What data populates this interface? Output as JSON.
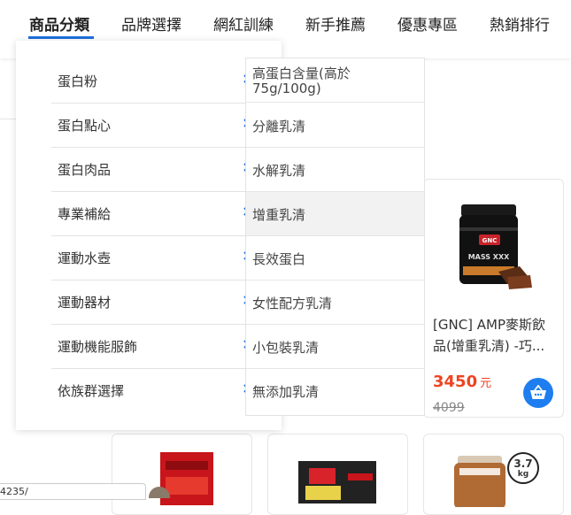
{
  "nav": {
    "items": [
      {
        "label": "商品分類"
      },
      {
        "label": "品牌選擇"
      },
      {
        "label": "網紅訓練"
      },
      {
        "label": "新手推薦"
      },
      {
        "label": "優惠專區"
      },
      {
        "label": "熱銷排行"
      }
    ],
    "active_index": 0,
    "accent_color": "#1e6fd9"
  },
  "menu": {
    "categories": [
      {
        "label": "蛋白粉"
      },
      {
        "label": "蛋白點心"
      },
      {
        "label": "蛋白肉品"
      },
      {
        "label": "專業補給"
      },
      {
        "label": "運動水壺"
      },
      {
        "label": "運動器材"
      },
      {
        "label": "運動機能服飾"
      },
      {
        "label": "依族群選擇"
      }
    ],
    "chevron_icon": "chevron-right-icon",
    "chevron_color": "#1e6fd9",
    "subcategories": [
      {
        "label": "高蛋白含量(高於75g/100g)"
      },
      {
        "label": "分離乳清"
      },
      {
        "label": "水解乳清"
      },
      {
        "label": "增重乳清"
      },
      {
        "label": "長效蛋白"
      },
      {
        "label": "女性配方乳清"
      },
      {
        "label": "小包裝乳清"
      },
      {
        "label": "無添加乳清"
      }
    ],
    "hovered_subcategory": 3
  },
  "product": {
    "title": "[GNC] AMP麥斯飲品(增重乳清) -巧...",
    "price": "3450",
    "price_unit": "元",
    "original_price": "4099",
    "image_text": "MASS XXX",
    "price_color": "#ee4422",
    "cart_icon": "shopping-basket-icon"
  },
  "bottom_products": {
    "badge_value": "3.7",
    "badge_unit": "kg"
  },
  "status_url": "4235/"
}
